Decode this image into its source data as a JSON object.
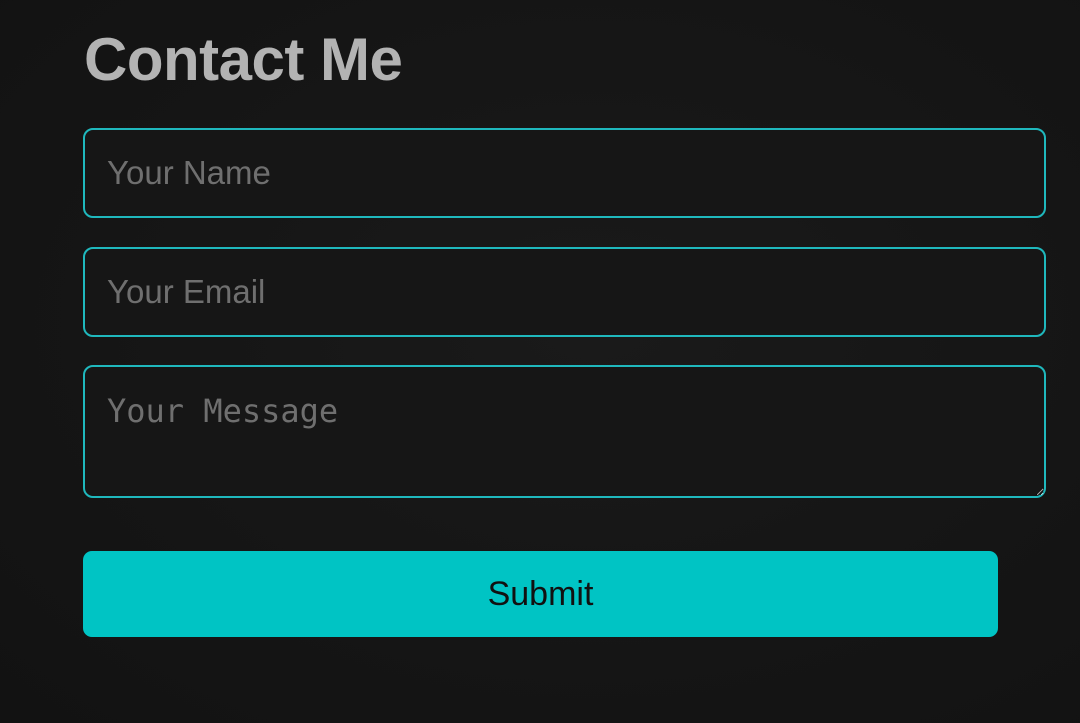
{
  "form": {
    "title": "Contact Me",
    "name_placeholder": "Your Name",
    "email_placeholder": "Your Email",
    "message_placeholder": "Your Message",
    "submit_label": "Submit"
  },
  "colors": {
    "background": "#141414",
    "accent": "#00c4c4",
    "field_border": "#1fb8bd",
    "title_text": "#b3b3b3",
    "placeholder_text": "#6f6f6f"
  }
}
